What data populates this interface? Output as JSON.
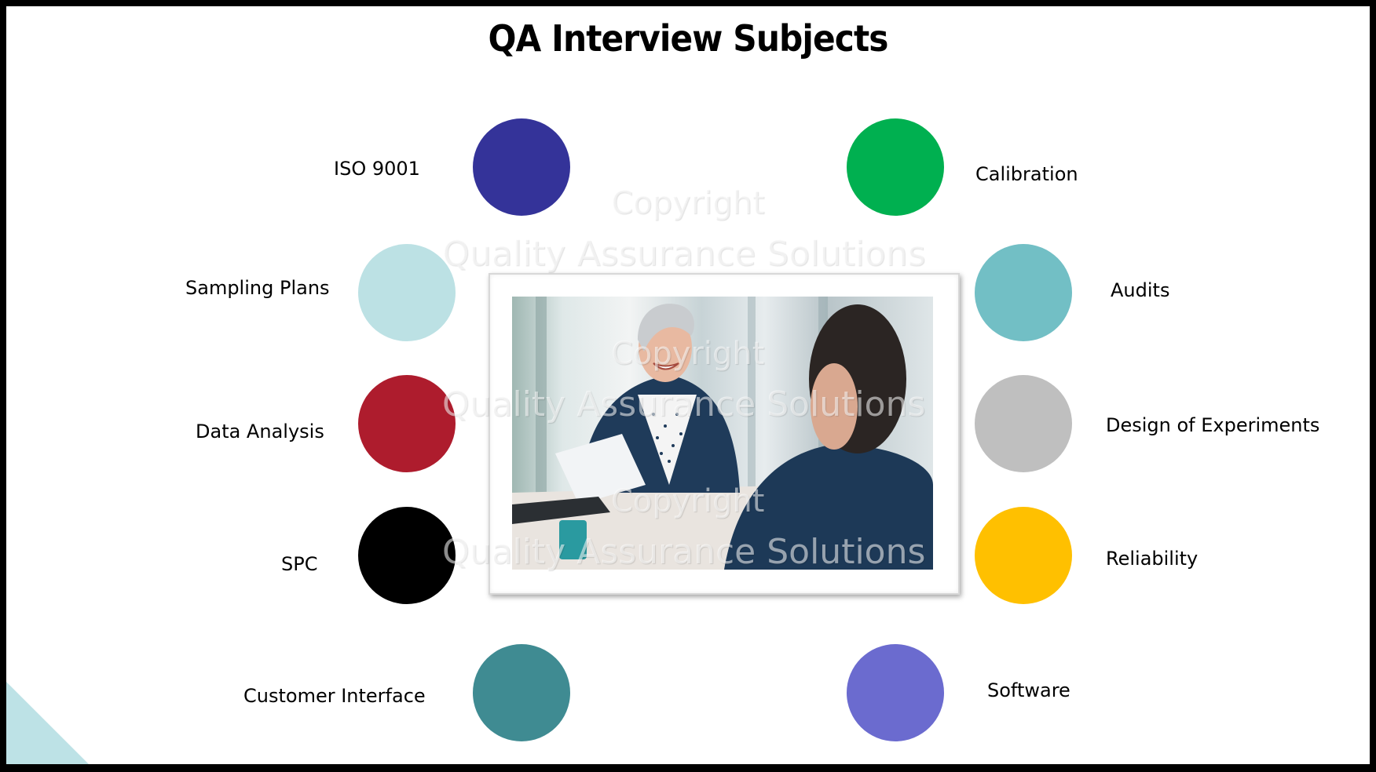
{
  "slide": {
    "title": "QA Interview Subjects",
    "accent_triangle_color": "#bde2e6"
  },
  "subjects": [
    {
      "label": "ISO 9001",
      "color": "#343399",
      "side": "left"
    },
    {
      "label": "Sampling Plans",
      "color": "#bce1e4",
      "side": "left"
    },
    {
      "label": "Data Analysis",
      "color": "#ae1c2d",
      "side": "left"
    },
    {
      "label": "SPC",
      "color": "#000000",
      "side": "left"
    },
    {
      "label": "Customer Interface",
      "color": "#3f8b92",
      "side": "left"
    },
    {
      "label": "Calibration",
      "color": "#00b050",
      "side": "right"
    },
    {
      "label": "Audits",
      "color": "#72bfc5",
      "side": "right"
    },
    {
      "label": "Design of Experiments",
      "color": "#bfbfbf",
      "side": "right"
    },
    {
      "label": "Reliability",
      "color": "#ffc000",
      "side": "right"
    },
    {
      "label": "Software",
      "color": "#6b6bcf",
      "side": "right"
    }
  ],
  "photo": {
    "description": "Smiling woman in navy blazer holding papers, facing man seen from behind at office table"
  },
  "watermark": {
    "line1": "Copyright",
    "line2": "Quality Assurance Solutions"
  }
}
